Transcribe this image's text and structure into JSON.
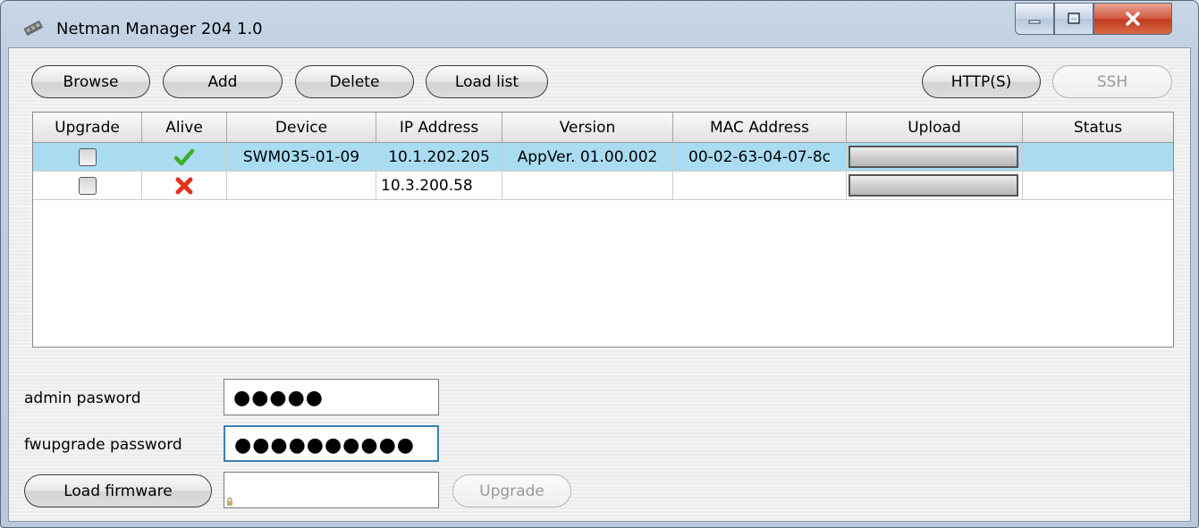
{
  "window": {
    "title": "Netman Manager 204 1.0",
    "controls": {
      "minimize": "minimize-icon",
      "maximize": "maximize-icon",
      "close": "close-icon"
    }
  },
  "toolbar": {
    "browse_label": "Browse",
    "add_label": "Add",
    "delete_label": "Delete",
    "load_list_label": "Load list",
    "https_label": "HTTP(S)",
    "ssh_label": "SSH"
  },
  "table": {
    "columns": [
      "Upgrade",
      "Alive",
      "Device",
      "IP Address",
      "Version",
      "MAC Address",
      "Upload",
      "Status"
    ],
    "rows": [
      {
        "upgrade": false,
        "alive": true,
        "alive_icon": "checkmark-icon",
        "device": "SWM035-01-09",
        "ip": "10.1.202.205",
        "version": "AppVer. 01.00.002",
        "mac": "00-02-63-04-07-8c",
        "upload_progress": 0,
        "status": "",
        "selected": true
      },
      {
        "upgrade": false,
        "alive": false,
        "alive_icon": "cross-icon",
        "device": "",
        "ip": "10.3.200.58",
        "version": "",
        "mac": "",
        "upload_progress": 0,
        "status": "",
        "selected": false
      }
    ]
  },
  "form": {
    "admin_password_label": "admin pasword",
    "admin_password_value": "●●●●●",
    "fwupgrade_password_label": "fwupgrade password",
    "fwupgrade_password_value": "●●●●●●●●●●",
    "firmware_path": "",
    "load_firmware_label": "Load firmware",
    "upgrade_label": "Upgrade"
  },
  "colors": {
    "selected_row": "#a9dcf1",
    "alive_ok": "#3cae2a",
    "alive_fail": "#e0321c",
    "title_bar": "#c9d7e6"
  }
}
